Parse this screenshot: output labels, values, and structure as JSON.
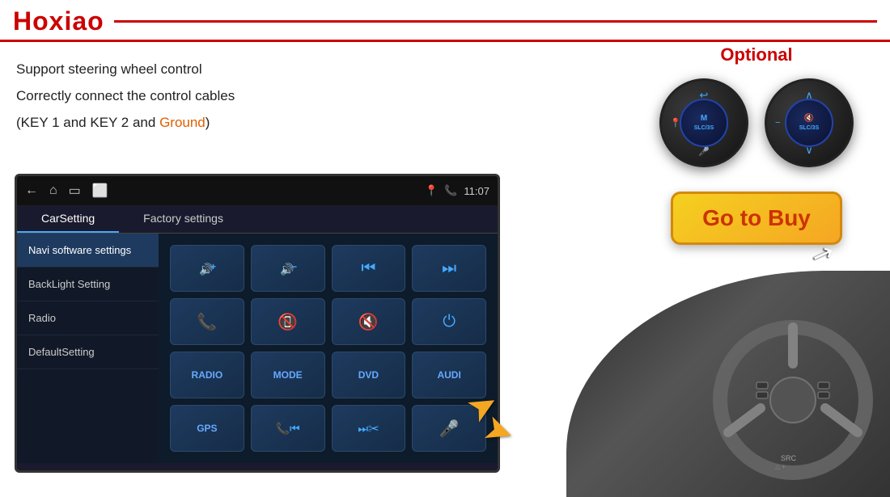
{
  "header": {
    "logo": "Hoxiao"
  },
  "left": {
    "line1": "Support steering wheel control",
    "line2": "Correctly connect the control cables",
    "line3_part1": "(KEY 1 and KEY 2 and ",
    "line3_highlight": "Ground",
    "line3_part2": ")"
  },
  "optional": {
    "label": "Optional"
  },
  "go_to_buy": {
    "label": "Go to Buy"
  },
  "screen": {
    "tab1": "CarSetting",
    "tab2": "Factory settings",
    "time": "11:07",
    "sidebar_items": [
      "Navi software settings",
      "BackLight Setting",
      "Radio",
      "DefaultSetting"
    ],
    "controls": [
      {
        "icon": "🔊+",
        "type": "icon"
      },
      {
        "icon": "🔊−",
        "type": "icon"
      },
      {
        "icon": "⏮",
        "type": "icon"
      },
      {
        "icon": "⏭",
        "type": "icon"
      },
      {
        "icon": "📞",
        "type": "icon"
      },
      {
        "icon": "📵",
        "type": "icon"
      },
      {
        "icon": "🔇",
        "type": "icon"
      },
      {
        "icon": "⏻",
        "type": "icon"
      },
      {
        "text": "RADIO",
        "type": "text"
      },
      {
        "text": "MODE",
        "type": "text"
      },
      {
        "text": "DVD",
        "type": "text"
      },
      {
        "text": "AUDI",
        "type": "text"
      },
      {
        "text": "GPS",
        "type": "text"
      },
      {
        "icon": "⏮📞",
        "type": "icon"
      },
      {
        "icon": "⏭✂",
        "type": "icon"
      },
      {
        "icon": "🎤",
        "type": "icon"
      }
    ]
  }
}
